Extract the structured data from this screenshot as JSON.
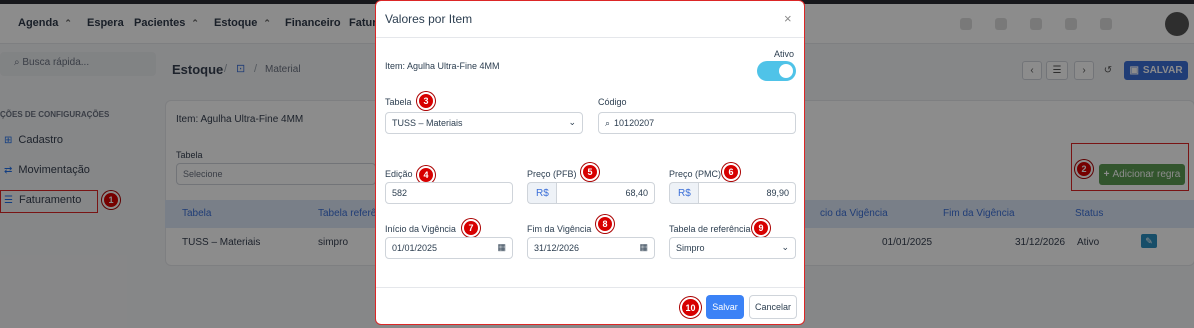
{
  "topnav": {
    "items": [
      "Agenda",
      "Espera",
      "Pacientes",
      "Estoque",
      "Financeiro",
      "Fatur"
    ]
  },
  "sidebar": {
    "search_placeholder": "Busca rápida...",
    "section_title": "ÇÕES DE CONFIGURAÇÕES",
    "items": [
      "Cadastro",
      "Movimentação",
      "Faturamento"
    ]
  },
  "page": {
    "title": "Estoque",
    "breadcrumb_sep": "/",
    "breadcrumb_item": "Material",
    "save_label": "SALVAR"
  },
  "background_card": {
    "item_label": "Item: Agulha Ultra-Fine 4MM",
    "tabela_label": "Tabela",
    "tabela_value": "Selecione",
    "add_rule_label": "Adicionar regra",
    "table_headers": [
      "Tabela",
      "Tabela referên",
      "cio da Vigência",
      "Fim da Vigência",
      "Status"
    ],
    "row": [
      "TUSS – Materiais",
      "simpro",
      "01/01/2025",
      "31/12/2026",
      "Ativo"
    ]
  },
  "modal": {
    "title": "Valores por Item",
    "item_label": "Item: Agulha Ultra-Fine 4MM",
    "ativo_label": "Ativo",
    "tabela_label": "Tabela",
    "tabela_value": "TUSS – Materiais",
    "codigo_label": "Código",
    "codigo_value": "10120207",
    "edicao_label": "Edição",
    "edicao_value": "582",
    "preco_pfb_label": "Preço (PFB)",
    "preco_pfb_value": "68,40",
    "preco_pmc_label": "Preço (PMC)",
    "preco_pmc_value": "89,90",
    "currency": "R$",
    "inicio_label": "Início da Vigência",
    "inicio_value": "01/01/2025",
    "fim_label": "Fim da Vigência",
    "fim_value": "31/12/2026",
    "ref_label": "Tabela de referência",
    "ref_value": "Simpro",
    "save_label": "Salvar",
    "cancel_label": "Cancelar"
  },
  "badges": [
    "1",
    "2",
    "3",
    "4",
    "5",
    "6",
    "7",
    "8",
    "9",
    "10"
  ],
  "colors": {
    "accent": "#3b6fd8",
    "success": "#5b9b52",
    "toggle": "#4fc3e8",
    "badge": "#d70000",
    "highlight": "#dc2626"
  }
}
